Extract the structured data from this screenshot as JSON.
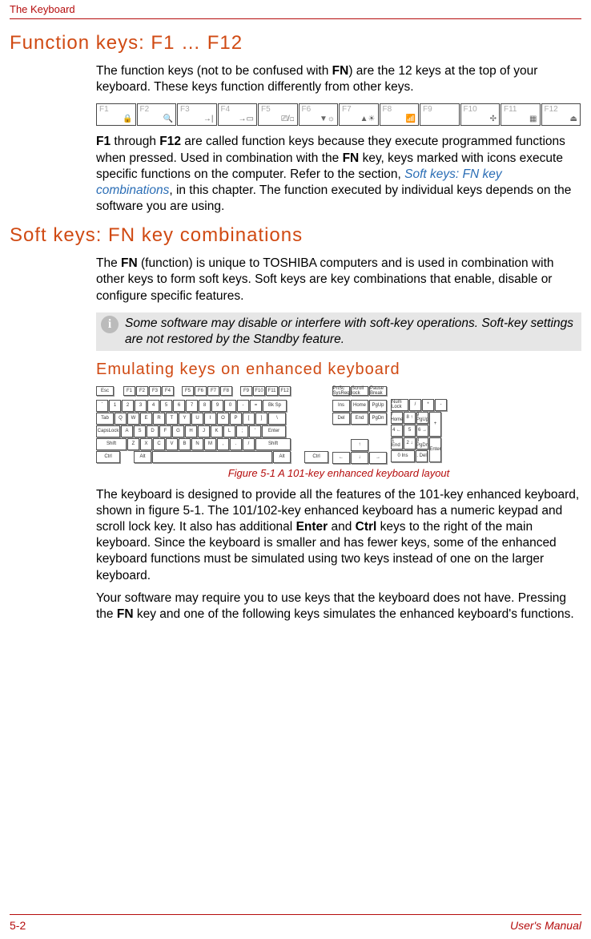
{
  "runhead": "The Keyboard",
  "h1": "Function keys: F1 … F12",
  "p1a": "The function keys (not to be confused with ",
  "p1b": ") are the 12 keys at the top of your keyboard. These keys function differently from other keys.",
  "fn_bold": "FN",
  "fnkeys": [
    "F1",
    "F2",
    "F3",
    "F4",
    "F5",
    "F6",
    "F7",
    "F8",
    "F9",
    "F10",
    "F11",
    "F12"
  ],
  "fnicons": [
    "🔒",
    "🔍",
    "→|",
    "→▭",
    "⎚/◻",
    "▼☼",
    "▲☀",
    "📶",
    " ",
    "✣",
    "▦",
    "⏏"
  ],
  "p2a": "F1",
  "p2b": " through ",
  "p2c": "F12",
  "p2d": " are called function keys because they execute programmed functions when pressed. Used in combination with the ",
  "p2e": " key, keys marked with icons execute specific functions on the computer. Refer to the section, ",
  "p2link": "Soft keys: FN key combinations",
  "p2f": ", in this chapter. The function executed by individual keys depends on the software you are using.",
  "h2a": "Soft keys: FN key combinations",
  "p3a": "The ",
  "p3b": " (function) is unique to TOSHIBA computers and is used in combination with other keys to form soft keys. Soft keys are key combinations that enable, disable or configure specific features.",
  "note": "Some software may disable or interfere with soft-key operations. Soft-key settings are not restored by the Standby feature.",
  "h2b": "Emulating keys on enhanced keyboard",
  "kbd": {
    "frow": [
      "Esc",
      "F1",
      "F2",
      "F3",
      "F4",
      "F5",
      "F6",
      "F7",
      "F8",
      "F9",
      "F10",
      "F11",
      "F12",
      "PrtSc SysReq",
      "Scroll lock",
      "Pause Break"
    ],
    "r1": [
      "`",
      "1",
      "2",
      "3",
      "4",
      "5",
      "6",
      "7",
      "8",
      "9",
      "0",
      "-",
      "=",
      "Bk Sp"
    ],
    "r2": [
      "Tab",
      "Q",
      "W",
      "E",
      "R",
      "T",
      "Y",
      "U",
      "I",
      "O",
      "P",
      "[",
      "]",
      "\\"
    ],
    "r3": [
      "CapsLock",
      "A",
      "S",
      "D",
      "F",
      "G",
      "H",
      "J",
      "K",
      "L",
      ";",
      "'",
      "Enter"
    ],
    "r4": [
      "Shift",
      "Z",
      "X",
      "C",
      "V",
      "B",
      "N",
      "M",
      ",",
      ".",
      "/",
      "Shift"
    ],
    "r5": [
      "Ctrl",
      "Alt",
      " ",
      "Alt",
      "Ctrl"
    ],
    "nav_top": [
      "Ins",
      "Home",
      "PgUp"
    ],
    "nav_bot": [
      "Del",
      "End",
      "PgDn"
    ],
    "arrows_top": [
      "↑"
    ],
    "arrows_bot": [
      "←",
      "↓",
      "→"
    ],
    "num": {
      "r0": [
        "Num Lock",
        "/",
        "*",
        "-"
      ],
      "r1": [
        "7 Home",
        "8 ↑",
        "9 PgUp"
      ],
      "r2": [
        "4 ←",
        "5",
        "6 →"
      ],
      "r3": [
        "1 End",
        "2 ↓",
        "3 PgDn"
      ],
      "r4": [
        "0 Ins",
        ". Del"
      ],
      "plus": "+",
      "enter": "Enter"
    }
  },
  "caption": "Figure 5-1 A 101-key enhanced keyboard layout",
  "p4a": "The keyboard is designed to provide all the features of the 101-key enhanced keyboard, shown in figure 5-1. The 101/102-key enhanced keyboard has a numeric keypad and scroll lock key. It also has additional ",
  "p4enter": "Enter",
  "p4b": " and ",
  "p4ctrl": "Ctrl",
  "p4c": " keys to the right of the main keyboard. Since the keyboard is smaller and has fewer keys, some of the enhanced keyboard functions must be simulated using two keys instead of one on the larger keyboard.",
  "p5a": "Your software may require you to use keys that the keyboard does not have. Pressing the ",
  "p5b": " key and one of the following keys simulates the enhanced keyboard's functions.",
  "footer_left": "5-2",
  "footer_right": "User's Manual"
}
